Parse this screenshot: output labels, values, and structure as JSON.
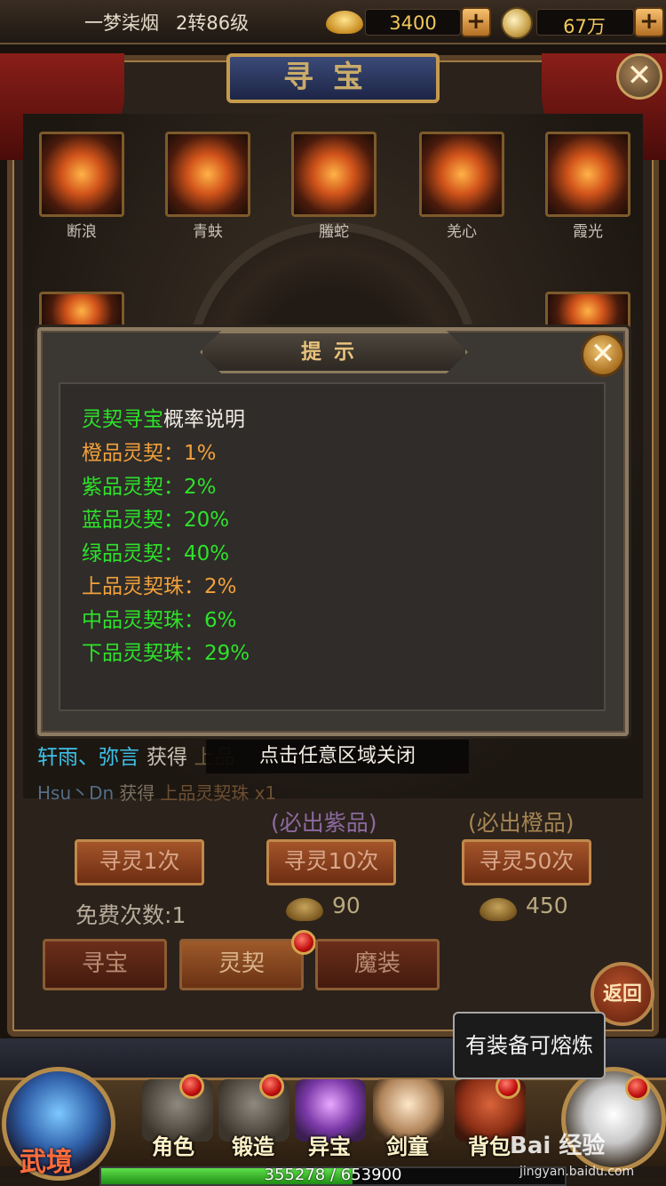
{
  "top": {
    "player_name": "一梦柒烟",
    "level": "2转86级",
    "gold": "3400",
    "coins": "67万"
  },
  "title": "寻宝",
  "slots": [
    {
      "label": "断浪"
    },
    {
      "label": "青蚨"
    },
    {
      "label": "螣蛇"
    },
    {
      "label": "羌心"
    },
    {
      "label": "霞光"
    }
  ],
  "log": {
    "line1_who": "轩雨、弥言",
    "line1_got": "获得",
    "line1_item": "上品",
    "line2_who": "Hsu丶Dn",
    "line2_got": "获得",
    "line2_item": "上品灵契珠 x1"
  },
  "toast": "点击任意区域关闭",
  "buttons": {
    "hint_10": "(必出紫品)",
    "hint_50": "(必出橙品)",
    "seek_1": "寻灵1次",
    "seek_10": "寻灵10次",
    "seek_50": "寻灵50次",
    "free_label": "免费次数:",
    "free_count": "1",
    "cost_10": "90",
    "cost_50": "450"
  },
  "tabs": [
    "寻宝",
    "灵契",
    "魔装"
  ],
  "return_label": "返回",
  "bubble": "有装备可熔炼",
  "nav": {
    "wujing": "武境",
    "items": [
      "角色",
      "锻造",
      "异宝",
      "剑童",
      "背包"
    ]
  },
  "exp": {
    "text": "355278 / 653900",
    "fraction": 0.543
  },
  "watermark": {
    "main": "Bai 经验",
    "sub": "jingyan.baidu.com"
  },
  "dialog": {
    "title": "提示",
    "heading_green": "灵契寻宝",
    "heading_white": "概率说明",
    "rows": [
      {
        "text": "橙品灵契：1%",
        "color": "orange"
      },
      {
        "text": "紫品灵契：2%",
        "color": "green"
      },
      {
        "text": "蓝品灵契：20%",
        "color": "green"
      },
      {
        "text": "绿品灵契：40%",
        "color": "green"
      },
      {
        "text": "上品灵契珠：2%",
        "color": "orange"
      },
      {
        "text": "中品灵契珠：6%",
        "color": "green"
      },
      {
        "text": "下品灵契珠：29%",
        "color": "green"
      }
    ]
  },
  "colors": {
    "green_text": "#2ee22a",
    "orange_text": "#f2a13b",
    "gold_value": "#f2c85b"
  }
}
